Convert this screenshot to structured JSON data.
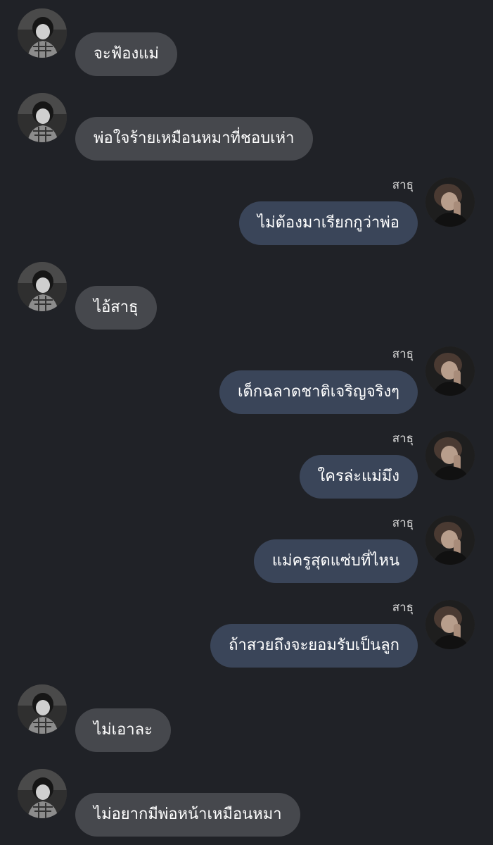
{
  "messages": [
    {
      "side": "in",
      "text": "จะฟ้องแม่"
    },
    {
      "side": "in",
      "text": "พ่อใจร้ายเหมือนหมาที่ชอบเห่า"
    },
    {
      "side": "out",
      "sender": "สาธุ",
      "text": "ไม่ต้องมาเรียกกูว่าพ่อ"
    },
    {
      "side": "in",
      "text": "ไอ้สาธุ"
    },
    {
      "side": "out",
      "sender": "สาธุ",
      "text": "เด็กฉลาดชาติเจริญจริงๆ"
    },
    {
      "side": "out",
      "sender": "สาธุ",
      "text": "ใครล่ะแม่มึง"
    },
    {
      "side": "out",
      "sender": "สาธุ",
      "text": "แม่ครูสุดแซ่บที่ไหน"
    },
    {
      "side": "out",
      "sender": "สาธุ",
      "text": "ถ้าสวยถึงจะยอมรับเป็นลูก"
    },
    {
      "side": "in",
      "text": "ไม่เอาละ"
    },
    {
      "side": "in",
      "text": "ไม่อยากมีพ่อหน้าเหมือนหมา"
    }
  ],
  "colors": {
    "background": "#202227",
    "incoming_bubble": "#46484d",
    "outgoing_bubble": "#3a4559",
    "text": "#ffffff",
    "sender_name": "#d8d8d8"
  }
}
